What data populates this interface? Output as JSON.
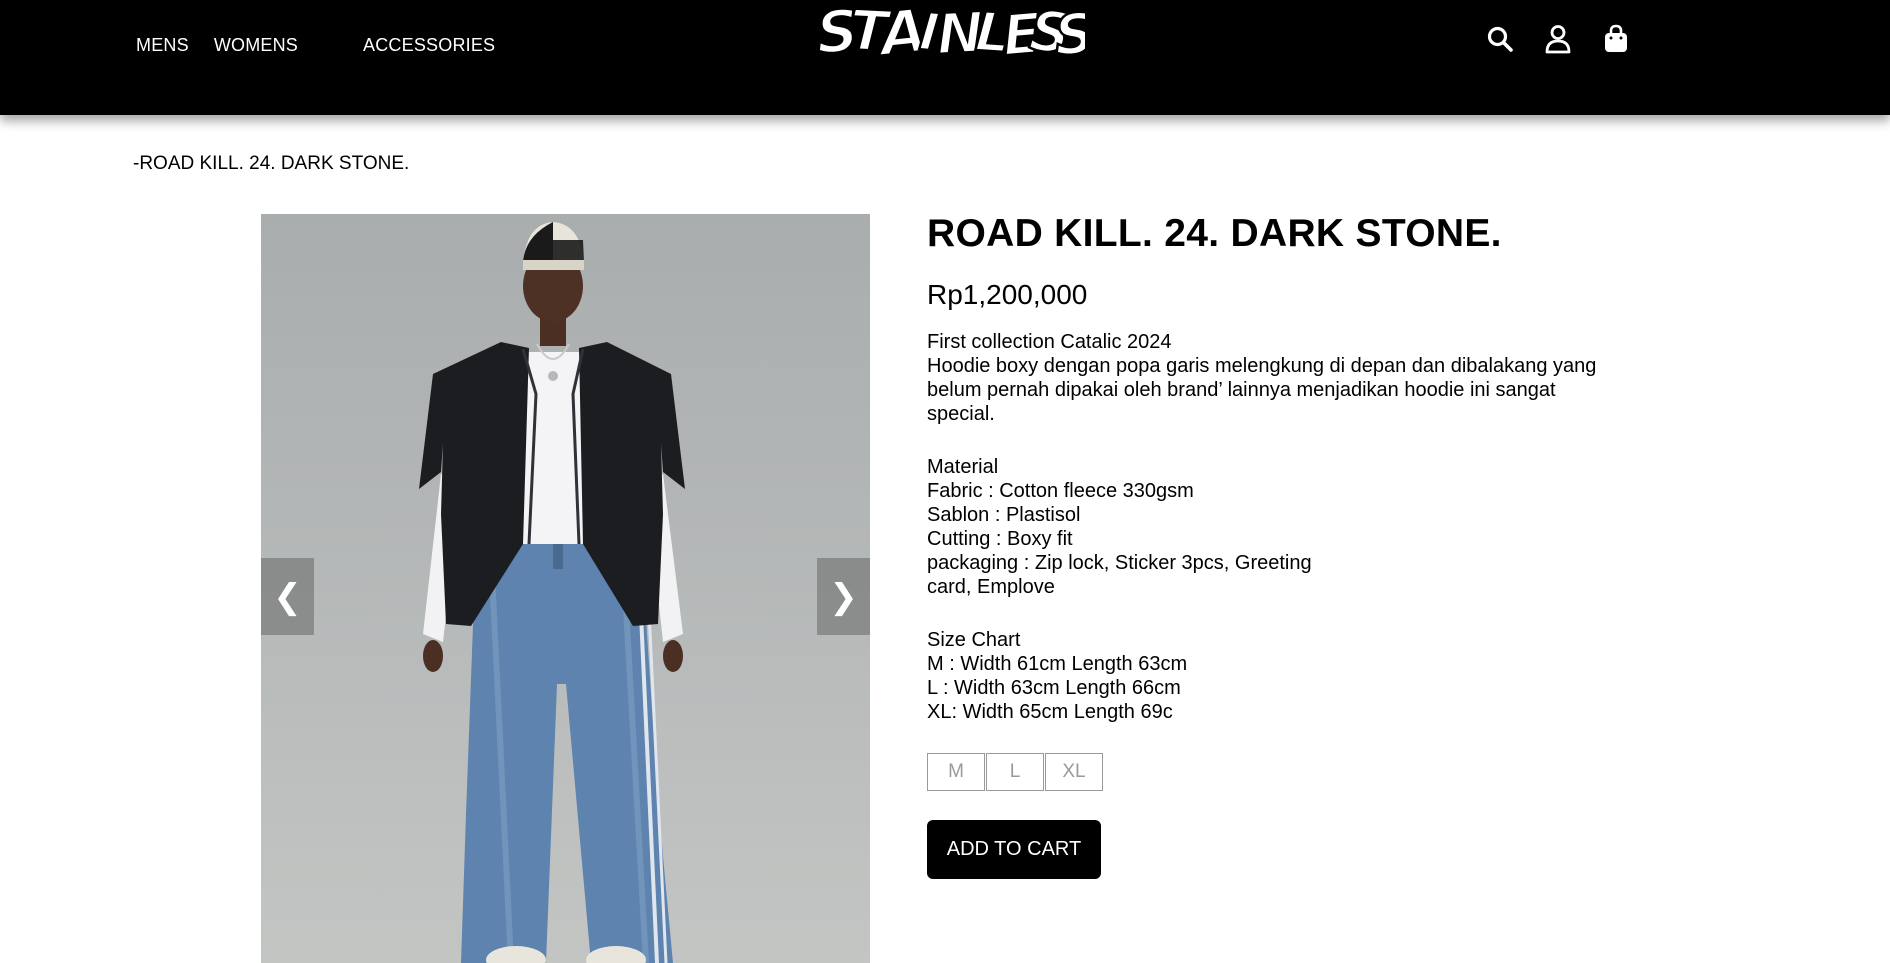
{
  "header": {
    "nav": [
      "MENS",
      "WOMENS",
      "ACCESSORIES"
    ],
    "logo_text": "STAINLESS",
    "icons": [
      "search-icon",
      "user-icon",
      "shopping-bag-icon"
    ],
    "background_color": "#000000"
  },
  "breadcrumb": "-ROAD KILL. 24. DARK STONE.",
  "gallery": {
    "prev_label": "❮",
    "next_label": "❯"
  },
  "product": {
    "title": "ROAD KILL. 24. DARK STONE.",
    "price": "Rp1,200,000",
    "description": [
      "First collection Catalic 2024",
      "Hoodie boxy dengan popa garis melengkung di depan dan dibalakang yang",
      "belum pernah dipakai oleh brand’ lainnya menjadikan hoodie ini sangat",
      "special."
    ],
    "material": [
      "Material",
      "Fabric : Cotton fleece 330gsm",
      "Sablon : Plastisol",
      "Cutting : Boxy fit",
      "packaging : Zip lock, Sticker 3pcs, Greeting",
      "card, Emplove"
    ],
    "size_chart": [
      "Size Chart",
      "M : Width 61cm Length 63cm",
      "L : Width 63cm Length 66cm",
      "XL: Width 65cm Length 69c"
    ],
    "sizes": [
      "M",
      "L",
      "XL"
    ],
    "add_to_cart": "ADD TO CART"
  }
}
